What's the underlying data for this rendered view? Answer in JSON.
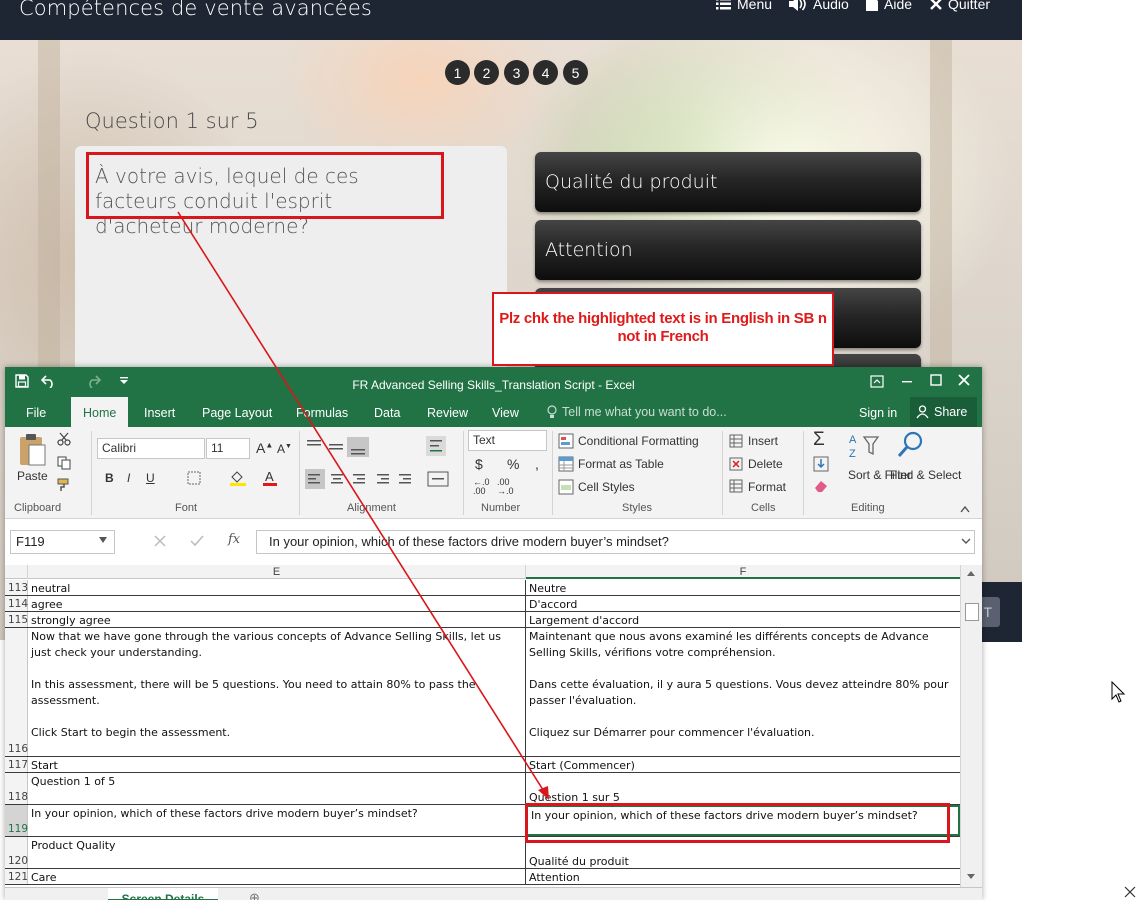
{
  "course": {
    "title": "Compétences de vente avancées",
    "menu": {
      "menu": "Menu",
      "audio": "Audio",
      "help": "Aide",
      "quit": "Quitter"
    },
    "pages": [
      "1",
      "2",
      "3",
      "4",
      "5"
    ],
    "question_counter": "Question 1 sur 5",
    "question": "À votre avis, lequel de ces facteurs conduit l'esprit d'acheteur moderne?",
    "answers": [
      "Qualité du produit",
      "Attention",
      "",
      ""
    ],
    "next_label": "T"
  },
  "annotation": {
    "comment": "Plz chk the highlighted text is in English in SB n not in French",
    "color": "#d9161c"
  },
  "excel": {
    "window_title": "FR Advanced Selling Skills_Translation Script - Excel",
    "tabs": [
      "File",
      "Home",
      "Insert",
      "Page Layout",
      "Formulas",
      "Data",
      "Review",
      "View"
    ],
    "tell_me": "Tell me what you want to do...",
    "sign_in": "Sign in",
    "share": "Share",
    "ribbon": {
      "paste": "Paste",
      "font_name": "Calibri",
      "font_size": "11",
      "number_format": "Text",
      "conditional_formatting": "Conditional Formatting",
      "format_as_table": "Format as Table",
      "cell_styles": "Cell Styles",
      "insert": "Insert",
      "delete": "Delete",
      "format": "Format",
      "sort_filter": "Sort & Filter",
      "find_select": "Find & Select",
      "groups": [
        "Clipboard",
        "Font",
        "Alignment",
        "Number",
        "Styles",
        "Cells",
        "Editing"
      ]
    },
    "name_box": "F119",
    "formula": "In your opinion, which of these factors drive modern buyer’s mindset?",
    "columns": [
      "E",
      "F"
    ],
    "rows": [
      {
        "num": "113",
        "e": "neutral",
        "f": "Neutre"
      },
      {
        "num": "114",
        "e": "agree",
        "f": "D'accord"
      },
      {
        "num": "115",
        "e": "strongly agree",
        "f": "Largement d'accord"
      },
      {
        "num": "116",
        "e": "Now that we have gone through the various concepts of Advance Selling Skills, let us just check your understanding.\n\nIn this assessment, there will be 5 questions. You need to attain 80% to pass the assessment.\n\nClick Start to begin the assessment.",
        "f": "Maintenant que nous avons examiné les différents concepts de Advance Selling Skills, vérifions votre compréhension.\n\nDans cette évaluation, il y aura 5 questions. Vous devez atteindre 80% pour passer l'évaluation.\n\nCliquez sur Démarrer pour commencer l'évaluation."
      },
      {
        "num": "117",
        "e": "Start",
        "f": "Start (Commencer)"
      },
      {
        "num": "118",
        "e": "Question 1 of 5",
        "f": "\nQuestion 1 sur 5"
      },
      {
        "num": "119",
        "e": "In your opinion, which of these factors drive modern buyer’s mindset?",
        "f": "In your opinion, which of these factors drive modern buyer’s mindset?"
      },
      {
        "num": "120",
        "e": "Product Quality",
        "f": "\nQualité du produit"
      },
      {
        "num": "121",
        "e": "Care",
        "f": "Attention"
      }
    ],
    "sheet_tab": "Screen Details"
  }
}
